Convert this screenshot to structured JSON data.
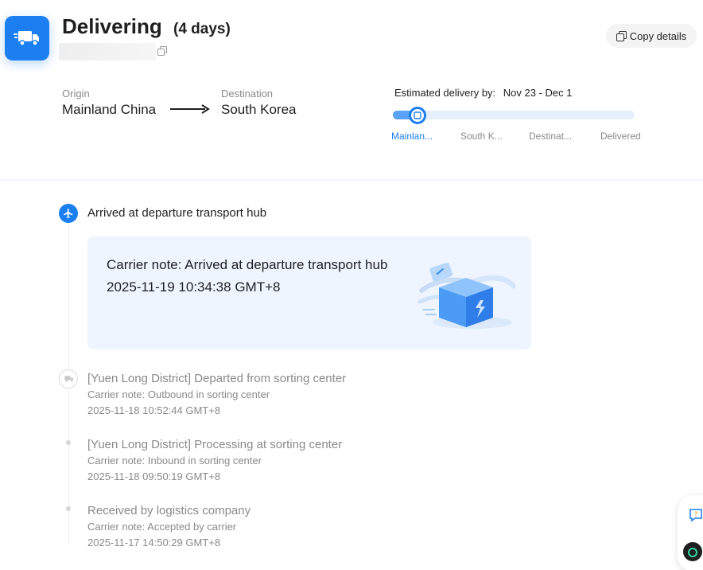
{
  "header": {
    "status": "Delivering",
    "duration": "(4 days)",
    "copy_details_label": "Copy details"
  },
  "route": {
    "origin_label": "Origin",
    "origin_value": "Mainland China",
    "destination_label": "Destination",
    "destination_value": "South Korea"
  },
  "eta": {
    "label": "Estimated delivery by:",
    "dates": "Nov 23 - Dec 1"
  },
  "progress": {
    "stages": [
      "Mainlan...",
      "South K...",
      "Destinat...",
      "Delivered"
    ],
    "active_stage_index": 0,
    "fill_fraction": 0.1
  },
  "timeline": {
    "current": {
      "title": "Arrived at departure transport hub",
      "note": "Carrier note: Arrived at departure transport hub",
      "time": "2025-11-19 10:34:38 GMT+8"
    },
    "events": [
      {
        "title": "[Yuen Long District] Departed from sorting center",
        "note": "Carrier note: Outbound in sorting center",
        "time": "2025-11-18 10:52:44 GMT+8"
      },
      {
        "title": "[Yuen Long District] Processing at sorting center",
        "note": "Carrier note: Inbound in sorting center",
        "time": "2025-11-18 09:50:19 GMT+8"
      },
      {
        "title": "Received by logistics company",
        "note": "Carrier note: Accepted by carrier",
        "time": "2025-11-17 14:50:29 GMT+8"
      }
    ]
  },
  "colors": {
    "accent": "#1b7ff1",
    "card_bg": "#eef5fe",
    "muted_text": "#8a8a8a"
  },
  "icons": {
    "status": "truck-icon",
    "current_event": "plane-icon",
    "copy": "copy-icon",
    "help": "help-icon"
  }
}
